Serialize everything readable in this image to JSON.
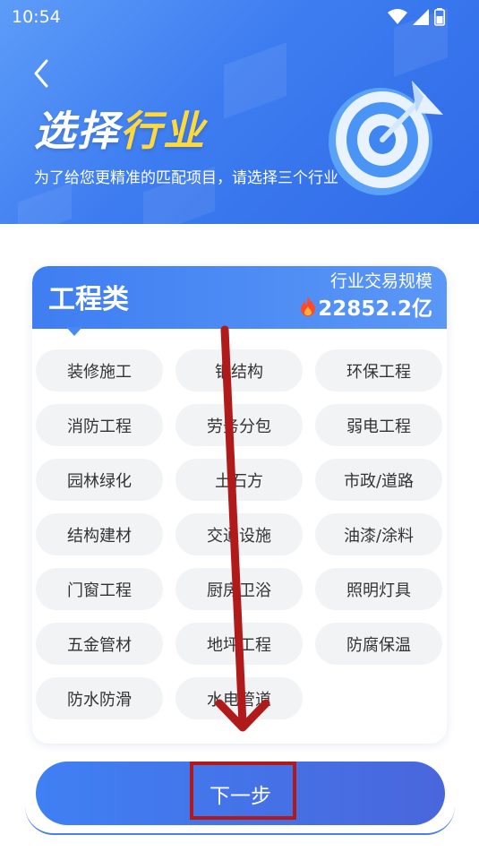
{
  "status_bar": {
    "time": "10:54"
  },
  "header": {
    "title_part1": "选择",
    "title_part2": "行业",
    "subtitle": "为了给您更精准的匹配项目，请选择三个行业"
  },
  "card": {
    "category": "工程类",
    "scale_label": "行业交易规模",
    "scale_value": "22852.2亿",
    "tags": [
      "装修施工",
      "钢结构",
      "环保工程",
      "消防工程",
      "劳务分包",
      "弱电工程",
      "园林绿化",
      "土石方",
      "市政/道路",
      "结构建材",
      "交通设施",
      "油漆/涂料",
      "门窗工程",
      "厨房卫浴",
      "照明灯具",
      "五金管材",
      "地坪工程",
      "防腐保温",
      "防水防滑",
      "水电管道"
    ]
  },
  "next_button": {
    "label": "下一步"
  },
  "colors": {
    "brand_blue": "#3f7ef2",
    "title_accent": "#ffd93b",
    "annotation_red": "#b01a1a"
  }
}
